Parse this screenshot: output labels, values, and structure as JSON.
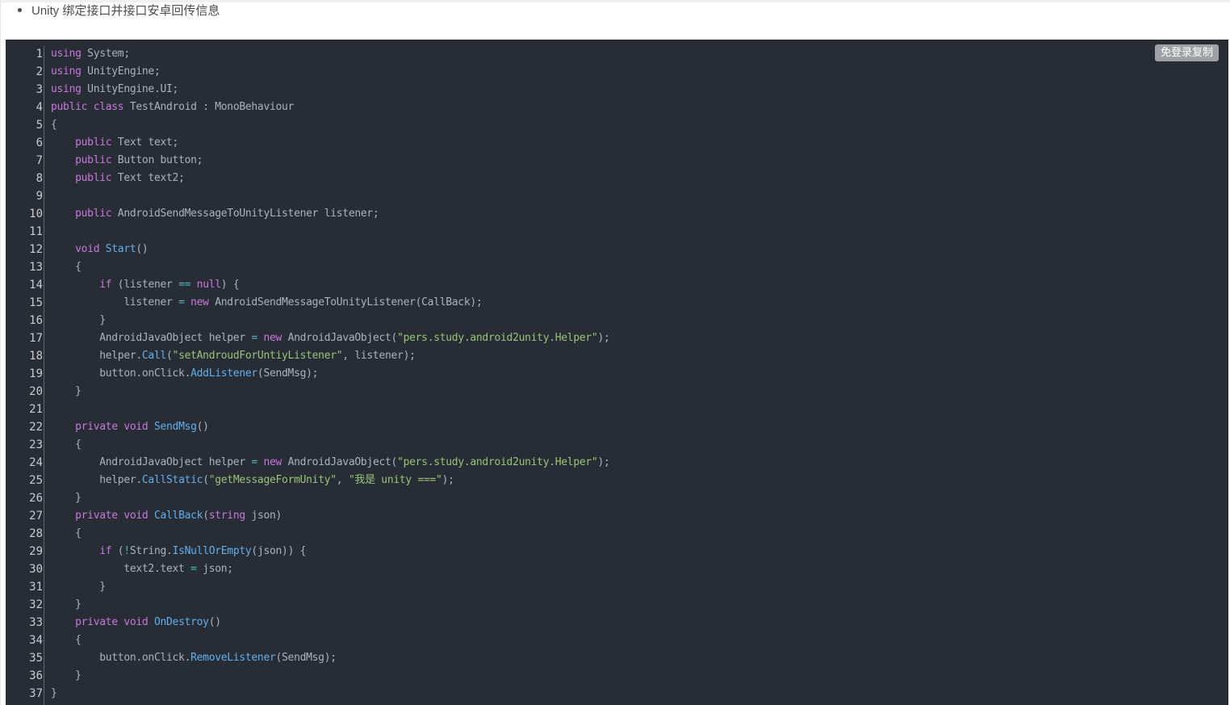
{
  "article": {
    "bullet_text": "Unity 绑定接口并接口安卓回传信息"
  },
  "code_block": {
    "copy_button_label": "免登录复制",
    "line_numbers": [
      "1",
      "2",
      "3",
      "4",
      "5",
      "6",
      "7",
      "8",
      "9",
      "10",
      "11",
      "12",
      "13",
      "14",
      "15",
      "16",
      "17",
      "18",
      "19",
      "20",
      "21",
      "22",
      "23",
      "24",
      "25",
      "26",
      "27",
      "28",
      "29",
      "30",
      "31",
      "32",
      "33",
      "34",
      "35",
      "36",
      "37"
    ],
    "lines": [
      [
        [
          "kw",
          "using"
        ],
        [
          "pl",
          " System;"
        ]
      ],
      [
        [
          "kw",
          "using"
        ],
        [
          "pl",
          " UnityEngine;"
        ]
      ],
      [
        [
          "kw",
          "using"
        ],
        [
          "pl",
          " UnityEngine.UI;"
        ]
      ],
      [
        [
          "kw",
          "public"
        ],
        [
          "pl",
          " "
        ],
        [
          "kw",
          "class"
        ],
        [
          "pl",
          " TestAndroid : MonoBehaviour"
        ]
      ],
      [
        [
          "pl",
          "{"
        ]
      ],
      [
        [
          "pl",
          "    "
        ],
        [
          "kw",
          "public"
        ],
        [
          "pl",
          " Text text;"
        ]
      ],
      [
        [
          "pl",
          "    "
        ],
        [
          "kw",
          "public"
        ],
        [
          "pl",
          " Button button;"
        ]
      ],
      [
        [
          "pl",
          "    "
        ],
        [
          "kw",
          "public"
        ],
        [
          "pl",
          " Text text2;"
        ]
      ],
      [
        [
          "pl",
          ""
        ]
      ],
      [
        [
          "pl",
          "    "
        ],
        [
          "kw",
          "public"
        ],
        [
          "pl",
          " AndroidSendMessageToUnityListener listener;"
        ]
      ],
      [
        [
          "pl",
          ""
        ]
      ],
      [
        [
          "pl",
          "    "
        ],
        [
          "kw",
          "void"
        ],
        [
          "pl",
          " "
        ],
        [
          "fn",
          "Start"
        ],
        [
          "pl",
          "()"
        ]
      ],
      [
        [
          "pl",
          "    {"
        ]
      ],
      [
        [
          "pl",
          "        "
        ],
        [
          "kw",
          "if"
        ],
        [
          "pl",
          " (listener "
        ],
        [
          "op",
          "=="
        ],
        [
          "pl",
          " "
        ],
        [
          "kw",
          "null"
        ],
        [
          "pl",
          ") {"
        ]
      ],
      [
        [
          "pl",
          "            listener "
        ],
        [
          "op",
          "="
        ],
        [
          "pl",
          " "
        ],
        [
          "kw",
          "new"
        ],
        [
          "pl",
          " AndroidSendMessageToUnityListener(CallBack);"
        ]
      ],
      [
        [
          "pl",
          "        }"
        ]
      ],
      [
        [
          "pl",
          "        AndroidJavaObject helper "
        ],
        [
          "op",
          "="
        ],
        [
          "pl",
          " "
        ],
        [
          "kw",
          "new"
        ],
        [
          "pl",
          " AndroidJavaObject("
        ],
        [
          "str",
          "\"pers.study.android2unity.Helper\""
        ],
        [
          "pl",
          ");"
        ]
      ],
      [
        [
          "pl",
          "        helper."
        ],
        [
          "fn",
          "Call"
        ],
        [
          "pl",
          "("
        ],
        [
          "str",
          "\"setAndroudForUntiyListener\""
        ],
        [
          "pl",
          ", listener);"
        ]
      ],
      [
        [
          "pl",
          "        button.onClick."
        ],
        [
          "fn",
          "AddListener"
        ],
        [
          "pl",
          "(SendMsg);"
        ]
      ],
      [
        [
          "pl",
          "    }"
        ]
      ],
      [
        [
          "pl",
          ""
        ]
      ],
      [
        [
          "pl",
          "    "
        ],
        [
          "kw",
          "private"
        ],
        [
          "pl",
          " "
        ],
        [
          "kw",
          "void"
        ],
        [
          "pl",
          " "
        ],
        [
          "fn",
          "SendMsg"
        ],
        [
          "pl",
          "()"
        ]
      ],
      [
        [
          "pl",
          "    {"
        ]
      ],
      [
        [
          "pl",
          "        AndroidJavaObject helper "
        ],
        [
          "op",
          "="
        ],
        [
          "pl",
          " "
        ],
        [
          "kw",
          "new"
        ],
        [
          "pl",
          " AndroidJavaObject("
        ],
        [
          "str",
          "\"pers.study.android2unity.Helper\""
        ],
        [
          "pl",
          ");"
        ]
      ],
      [
        [
          "pl",
          "        helper."
        ],
        [
          "fn",
          "CallStatic"
        ],
        [
          "pl",
          "("
        ],
        [
          "str",
          "\"getMessageFormUnity\""
        ],
        [
          "pl",
          ", "
        ],
        [
          "str",
          "\"我是 unity ===\""
        ],
        [
          "pl",
          ");"
        ]
      ],
      [
        [
          "pl",
          "    }"
        ]
      ],
      [
        [
          "pl",
          "    "
        ],
        [
          "kw",
          "private"
        ],
        [
          "pl",
          " "
        ],
        [
          "kw",
          "void"
        ],
        [
          "pl",
          " "
        ],
        [
          "fn",
          "CallBack"
        ],
        [
          "pl",
          "("
        ],
        [
          "kw",
          "string"
        ],
        [
          "pl",
          " json)"
        ]
      ],
      [
        [
          "pl",
          "    {"
        ]
      ],
      [
        [
          "pl",
          "        "
        ],
        [
          "kw",
          "if"
        ],
        [
          "pl",
          " ("
        ],
        [
          "op",
          "!"
        ],
        [
          "pl",
          "String."
        ],
        [
          "fn",
          "IsNullOrEmpty"
        ],
        [
          "pl",
          "(json)) {"
        ]
      ],
      [
        [
          "pl",
          "            text2.text "
        ],
        [
          "op",
          "="
        ],
        [
          "pl",
          " json;"
        ]
      ],
      [
        [
          "pl",
          "        }"
        ]
      ],
      [
        [
          "pl",
          "    }"
        ]
      ],
      [
        [
          "pl",
          "    "
        ],
        [
          "kw",
          "private"
        ],
        [
          "pl",
          " "
        ],
        [
          "kw",
          "void"
        ],
        [
          "pl",
          " "
        ],
        [
          "fn",
          "OnDestroy"
        ],
        [
          "pl",
          "()"
        ]
      ],
      [
        [
          "pl",
          "    {"
        ]
      ],
      [
        [
          "pl",
          "        button.onClick."
        ],
        [
          "fn",
          "RemoveListener"
        ],
        [
          "pl",
          "(SendMsg);"
        ]
      ],
      [
        [
          "pl",
          "    }"
        ]
      ],
      [
        [
          "pl",
          "}"
        ]
      ]
    ]
  },
  "colors": {
    "code_background": "#282c34",
    "keyword": "#c678dd",
    "function": "#61afef",
    "string": "#98c379",
    "operator": "#56b6c2",
    "plain": "#abb2bf",
    "copy_button": "#9ea1a6"
  }
}
